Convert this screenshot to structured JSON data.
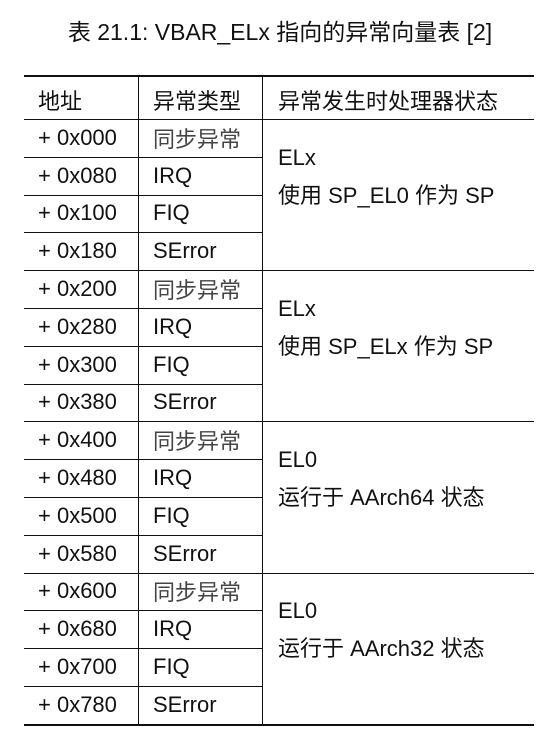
{
  "caption": "表 21.1: VBAR_ELx 指向的异常向量表 [2]",
  "headers": {
    "address": "地址",
    "type": "异常类型",
    "state": "异常发生时处理器状态"
  },
  "groups": [
    {
      "rows": [
        {
          "address": "+ 0x000",
          "type": "同步异常"
        },
        {
          "address": "+ 0x080",
          "type": "IRQ"
        },
        {
          "address": "+ 0x100",
          "type": "FIQ"
        },
        {
          "address": "+ 0x180",
          "type": "SError"
        }
      ],
      "state_line1": "ELx",
      "state_line2": "使用 SP_EL0 作为 SP"
    },
    {
      "rows": [
        {
          "address": "+ 0x200",
          "type": "同步异常"
        },
        {
          "address": "+ 0x280",
          "type": "IRQ"
        },
        {
          "address": "+ 0x300",
          "type": "FIQ"
        },
        {
          "address": "+ 0x380",
          "type": "SError"
        }
      ],
      "state_line1": "ELx",
      "state_line2": "使用 SP_ELx 作为 SP"
    },
    {
      "rows": [
        {
          "address": "+ 0x400",
          "type": "同步异常"
        },
        {
          "address": "+ 0x480",
          "type": "IRQ"
        },
        {
          "address": "+ 0x500",
          "type": "FIQ"
        },
        {
          "address": "+ 0x580",
          "type": "SError"
        }
      ],
      "state_line1": "EL0",
      "state_line2": "运行于 AArch64 状态"
    },
    {
      "rows": [
        {
          "address": "+ 0x600",
          "type": "同步异常"
        },
        {
          "address": "+ 0x680",
          "type": "IRQ"
        },
        {
          "address": "+ 0x700",
          "type": "FIQ"
        },
        {
          "address": "+ 0x780",
          "type": "SError"
        }
      ],
      "state_line1": "EL0",
      "state_line2": "运行于 AArch32 状态"
    }
  ]
}
